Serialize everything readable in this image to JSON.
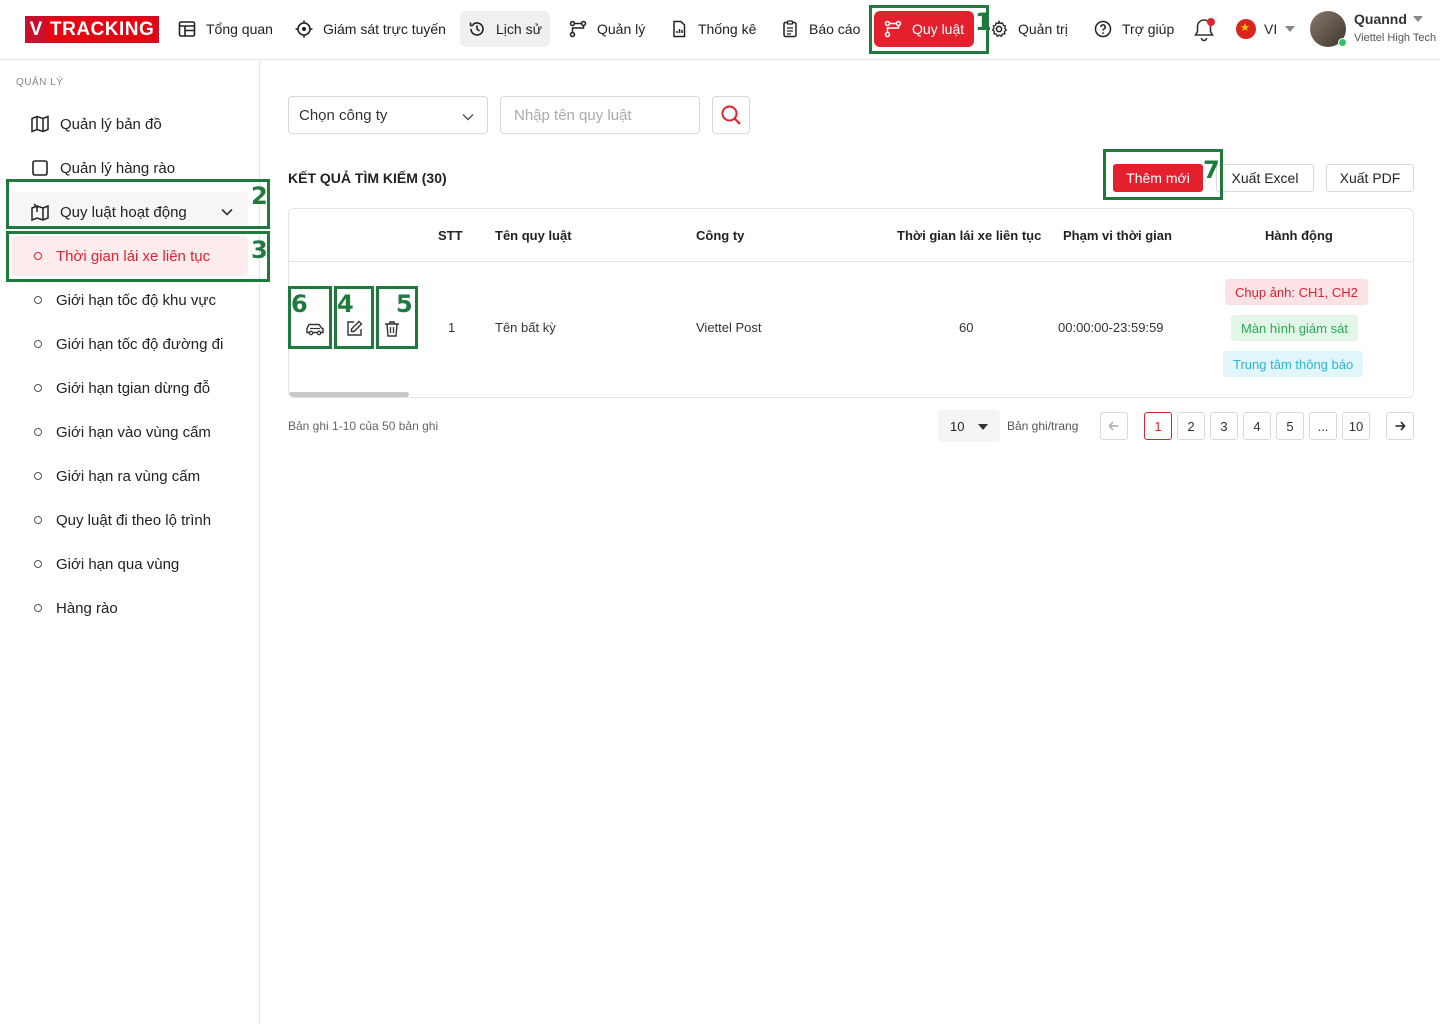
{
  "brand": {
    "logo_v": "V",
    "logo_text": "TRACKING"
  },
  "nav": [
    {
      "label": "Tổng quan",
      "icon": "dashboard-icon"
    },
    {
      "label": "Giám sát trực tuyến",
      "icon": "crosshair-icon"
    },
    {
      "label": "Lịch sử",
      "icon": "history-icon"
    },
    {
      "label": "Quản lý",
      "icon": "route-icon"
    },
    {
      "label": "Thống kê",
      "icon": "chart-file-icon"
    },
    {
      "label": "Báo cáo",
      "icon": "clipboard-icon"
    },
    {
      "label": "Quy luật",
      "icon": "route-icon"
    },
    {
      "label": "Quản trị",
      "icon": "gear-icon"
    },
    {
      "label": "Trợ giúp",
      "icon": "help-icon"
    }
  ],
  "active_nav": "Quy luật",
  "language": "VI",
  "user": {
    "name": "Quannd",
    "org": "Viettel High Tech"
  },
  "sidebar": {
    "section": "QUẢN LÝ",
    "items": [
      {
        "label": "Quản lý bản đồ",
        "icon": "map-icon"
      },
      {
        "label": "Quản lý hàng rào",
        "icon": "square-icon"
      },
      {
        "label": "Quy luật hoạt động",
        "icon": "map-rule-icon"
      }
    ],
    "sub_items": [
      "Thời gian lái xe liên tục",
      "Giới hạn tốc độ khu vực",
      "Giới hạn tốc độ đường đi",
      "Giới hạn tgian dừng đỗ",
      "Giới hạn vào vùng cấm",
      "Giới hạn ra vùng cấm",
      "Quy luật đi theo lộ trình",
      "Giới hạn qua vùng",
      "Hàng rào"
    ],
    "active_sub": "Thời gian lái xe liên tục"
  },
  "filters": {
    "company_placeholder": "Chọn công ty",
    "rule_name_placeholder": "Nhập tên quy luật"
  },
  "results": {
    "title": "KẾT QUẢ TÌM KIẾM (30)",
    "add_label": "Thêm mới",
    "excel_label": "Xuất Excel",
    "pdf_label": "Xuất PDF"
  },
  "table": {
    "headers": [
      "STT",
      "Tên quy luật",
      "Công ty",
      "Thời gian lái xe liên tục",
      "Phạm vi thời gian",
      "Hành động"
    ],
    "rows": [
      {
        "stt": "1",
        "name": "Tên bất kỳ",
        "company": "Viettel Post",
        "continuous_time": "60",
        "time_range": "00:00:00-23:59:59",
        "actions": [
          "Chụp ảnh: CH1, CH2",
          "Màn hình giám sát",
          "Trung tâm thông báo"
        ]
      }
    ]
  },
  "pagination": {
    "info": "Bản ghi 1-10 của 50 bản ghi",
    "per_page": "10",
    "per_page_label": "Bản ghi/trang",
    "pages": [
      "1",
      "2",
      "3",
      "4",
      "5",
      "...",
      "10"
    ],
    "current": "1"
  },
  "annotations": [
    "1",
    "2",
    "3",
    "4",
    "5",
    "6",
    "7"
  ],
  "colors": {
    "accent": "#e4202f",
    "highlight": "#1f7a3e"
  }
}
